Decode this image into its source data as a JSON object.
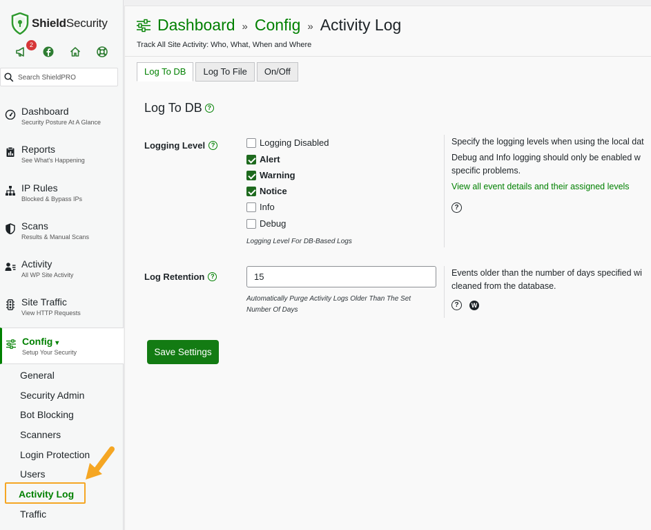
{
  "brand": {
    "name_bold": "Shield",
    "name_light": "Security"
  },
  "notifications": {
    "count": "2"
  },
  "search": {
    "placeholder": "Search ShieldPRO"
  },
  "nav": [
    {
      "title": "Dashboard",
      "sub": "Security Posture At A Glance"
    },
    {
      "title": "Reports",
      "sub": "See What's Happening"
    },
    {
      "title": "IP Rules",
      "sub": "Blocked & Bypass IPs"
    },
    {
      "title": "Scans",
      "sub": "Results & Manual Scans"
    },
    {
      "title": "Activity",
      "sub": "All WP Site Activity"
    },
    {
      "title": "Site Traffic",
      "sub": "View HTTP Requests"
    },
    {
      "title": "Config",
      "sub": "Setup Your Security"
    }
  ],
  "config_caret": "▾",
  "config_sub": [
    "General",
    "Security Admin",
    "Bot Blocking",
    "Scanners",
    "Login Protection",
    "Users",
    "Activity Log",
    "Traffic"
  ],
  "breadcrumb": {
    "dashboard": "Dashboard",
    "config": "Config",
    "current": "Activity Log",
    "sep": "»"
  },
  "page_subtitle": "Track All Site Activity: Who, What, When and Where",
  "tabs": [
    "Log To DB",
    "Log To File",
    "On/Off"
  ],
  "section": {
    "title": "Log To DB"
  },
  "logging_level": {
    "label": "Logging Level",
    "options": [
      {
        "label": "Logging Disabled",
        "checked": false
      },
      {
        "label": "Alert",
        "checked": true
      },
      {
        "label": "Warning",
        "checked": true
      },
      {
        "label": "Notice",
        "checked": true
      },
      {
        "label": "Info",
        "checked": false
      },
      {
        "label": "Debug",
        "checked": false
      }
    ],
    "note": "Logging Level For DB-Based Logs",
    "desc_line1": "Specify the logging levels when using the local dat",
    "desc_line2": "Debug and Info logging should only be enabled w",
    "desc_line3": "specific problems.",
    "link": "View all event details and their assigned levels"
  },
  "log_retention": {
    "label": "Log Retention",
    "value": "15",
    "note_line1": "Automatically Purge Activity Logs Older Than The Set",
    "note_line2": "Number Of Days",
    "desc_line1": "Events older than the number of days specified wi",
    "desc_line2": "cleaned from the database."
  },
  "save_button": "Save Settings",
  "colors": {
    "accent": "#008000",
    "button": "#137b13",
    "highlight": "#f5a623",
    "badge": "#d63638"
  }
}
